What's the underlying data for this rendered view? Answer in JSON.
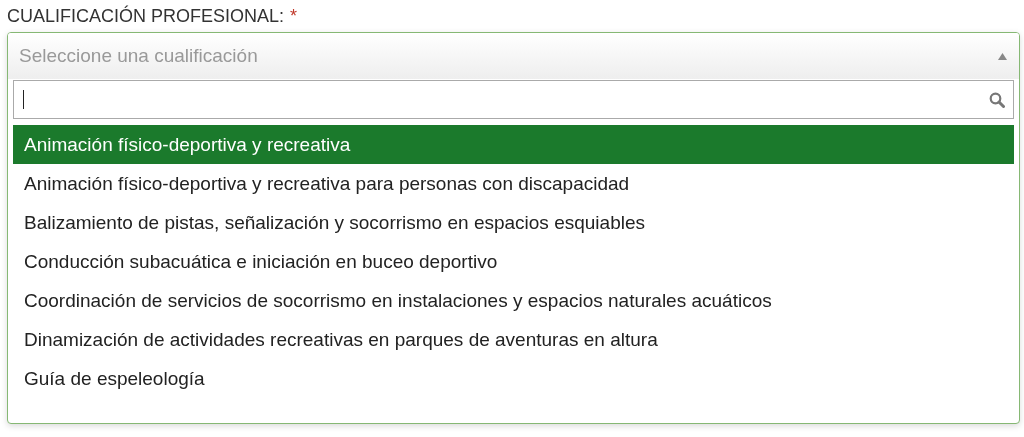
{
  "field": {
    "label": "CUALIFICACIÓN PROFESIONAL:",
    "required_mark": "*",
    "placeholder": "Seleccione una cualificación",
    "expanded": true
  },
  "options": [
    {
      "label": "Animación físico-deportiva y recreativa",
      "selected": true
    },
    {
      "label": "Animación físico-deportiva y recreativa para personas con discapacidad",
      "selected": false
    },
    {
      "label": "Balizamiento de pistas, señalización y socorrismo en espacios esquiables",
      "selected": false
    },
    {
      "label": "Conducción subacuática e iniciación en buceo deportivo",
      "selected": false
    },
    {
      "label": "Coordinación de servicios de socorrismo en instalaciones y espacios naturales acuáticos",
      "selected": false
    },
    {
      "label": "Dinamización de actividades recreativas en parques de aventuras en altura",
      "selected": false
    },
    {
      "label": "Guía de espeleología",
      "selected": false
    }
  ]
}
